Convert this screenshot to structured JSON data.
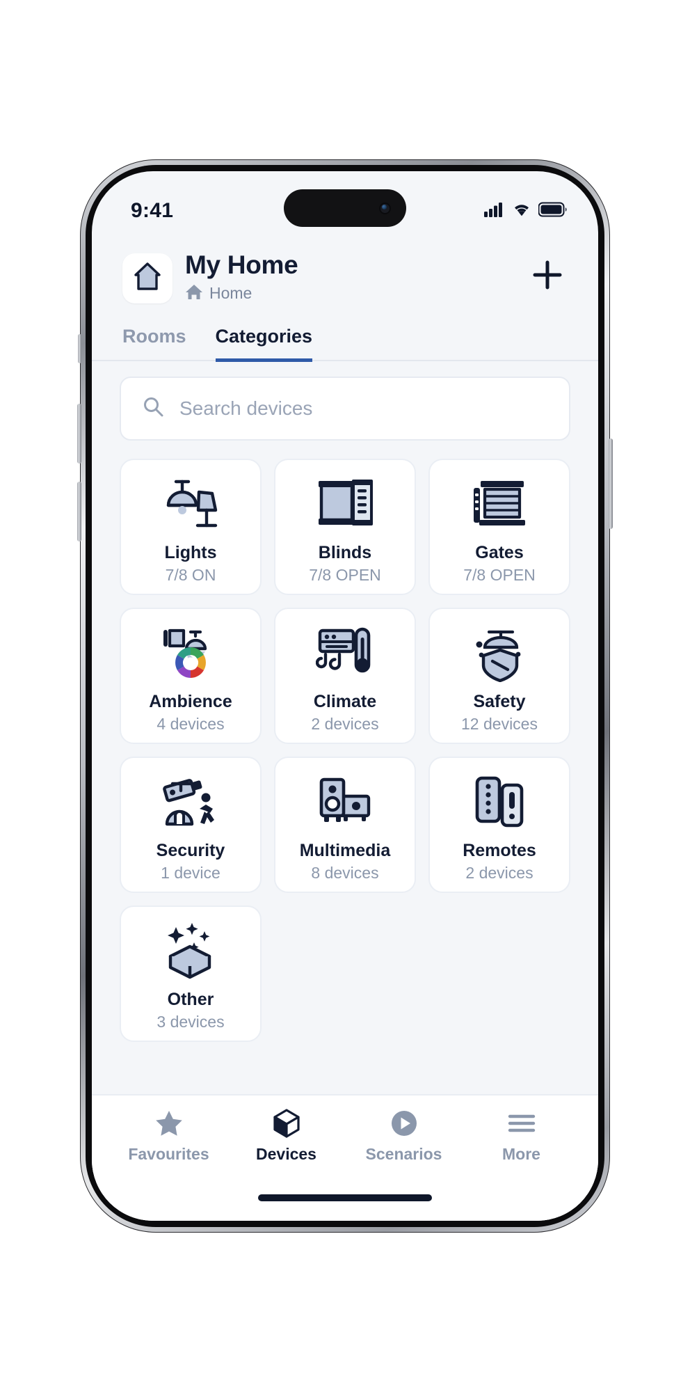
{
  "statusbar": {
    "time": "9:41",
    "cellular_icon": "cellular-signal-icon",
    "wifi_icon": "wifi-icon",
    "battery_icon": "battery-icon"
  },
  "header": {
    "home_icon": "house-outline-icon",
    "title": "My Home",
    "subtitle": "Home",
    "subtitle_icon": "house-filled-icon",
    "add_label": "+",
    "add_icon": "plus-icon"
  },
  "tabs": [
    {
      "label": "Rooms",
      "active": false
    },
    {
      "label": "Categories",
      "active": true
    }
  ],
  "search": {
    "placeholder": "Search devices",
    "value": "",
    "icon": "search-icon"
  },
  "categories": [
    {
      "label": "Lights",
      "meta": "7/8 ON",
      "icon": "lamp-icon"
    },
    {
      "label": "Blinds",
      "meta": "7/8 OPEN",
      "icon": "blinds-icon"
    },
    {
      "label": "Gates",
      "meta": "7/8 OPEN",
      "icon": "gate-icon"
    },
    {
      "label": "Ambience",
      "meta": "4 devices",
      "icon": "color-wheel-icon"
    },
    {
      "label": "Climate",
      "meta": "2 devices",
      "icon": "thermostat-icon"
    },
    {
      "label": "Safety",
      "meta": "12 devices",
      "icon": "shield-icon"
    },
    {
      "label": "Security",
      "meta": "1 device",
      "icon": "cctv-icon"
    },
    {
      "label": "Multimedia",
      "meta": "8 devices",
      "icon": "speaker-icon"
    },
    {
      "label": "Remotes",
      "meta": "2 devices",
      "icon": "remote-control-icon"
    },
    {
      "label": "Other",
      "meta": "3 devices",
      "icon": "sparkle-box-icon"
    }
  ],
  "bottom_nav": [
    {
      "label": "Favourites",
      "icon": "star-icon",
      "active": false
    },
    {
      "label": "Devices",
      "icon": "cube-icon",
      "active": true
    },
    {
      "label": "Scenarios",
      "icon": "play-circle-icon",
      "active": false
    },
    {
      "label": "More",
      "icon": "hamburger-icon",
      "active": false
    }
  ],
  "colors": {
    "accent": "#2f5aa8",
    "ink": "#131c33",
    "muted": "#8b97ab",
    "surface": "#ffffff",
    "background": "#f4f6f9",
    "icon_fill": "#bdc9de"
  }
}
